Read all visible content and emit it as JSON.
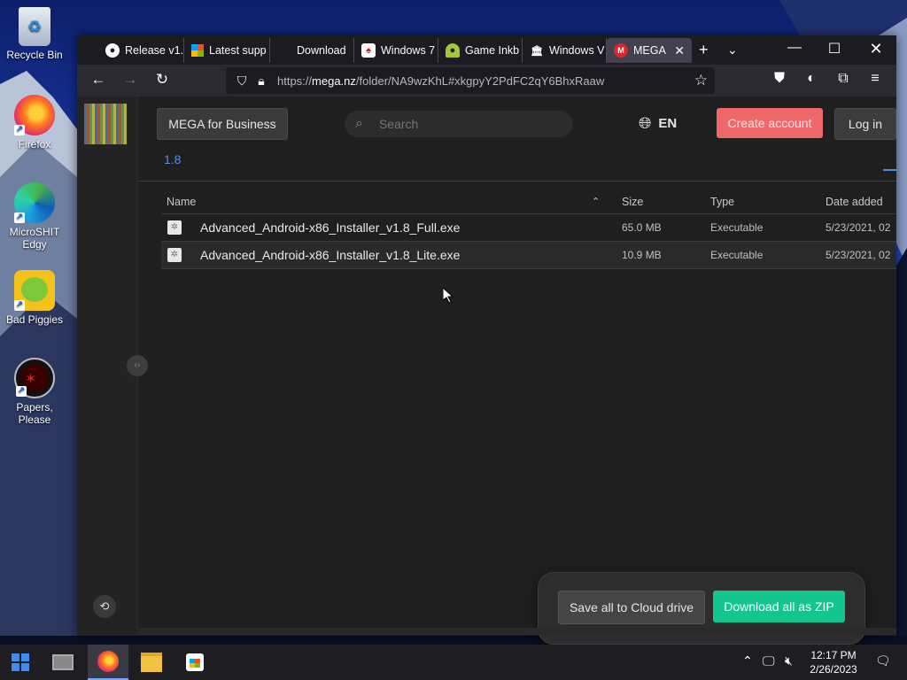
{
  "desktop": {
    "icons": [
      {
        "label": "Recycle Bin"
      },
      {
        "label": "Firefox"
      },
      {
        "label": "MicroSHIT Edgy"
      },
      {
        "label": "Bad Piggies"
      },
      {
        "label": "Papers, Please"
      }
    ]
  },
  "browser": {
    "tabs": [
      {
        "label": "Release v1."
      },
      {
        "label": "Latest supp"
      },
      {
        "label": "Download"
      },
      {
        "label": "Windows 7"
      },
      {
        "label": "Game Inkb"
      },
      {
        "label": "Windows V"
      },
      {
        "label": "MEGA"
      }
    ],
    "url_prefix": "https://",
    "url_domain": "mega.nz",
    "url_path": "/folder/NA9wzKhL#xkgpyY2PdFC2qY6BhxRaaw"
  },
  "mega": {
    "business_label": "MEGA for Business",
    "search_placeholder": "Search",
    "language": "EN",
    "create_account_label": "Create account",
    "login_label": "Log in",
    "breadcrumb": "1.8",
    "columns": {
      "name": "Name",
      "size": "Size",
      "type": "Type",
      "date": "Date added"
    },
    "files": [
      {
        "name": "Advanced_Android-x86_Installer_v1.8_Full.exe",
        "size": "65.0 MB",
        "type": "Executable",
        "date": "5/23/2021, 02"
      },
      {
        "name": "Advanced_Android-x86_Installer_v1.8_Lite.exe",
        "size": "10.9 MB",
        "type": "Executable",
        "date": "5/23/2021, 02"
      }
    ],
    "save_all_label": "Save all to Cloud drive",
    "download_zip_label": "Download all as ZIP"
  },
  "taskbar": {
    "time": "12:17 PM",
    "date": "2/26/2023"
  },
  "colors": {
    "accent_green": "#13c58f",
    "accent_red": "#f0696a",
    "link_blue": "#5a8ce6"
  }
}
